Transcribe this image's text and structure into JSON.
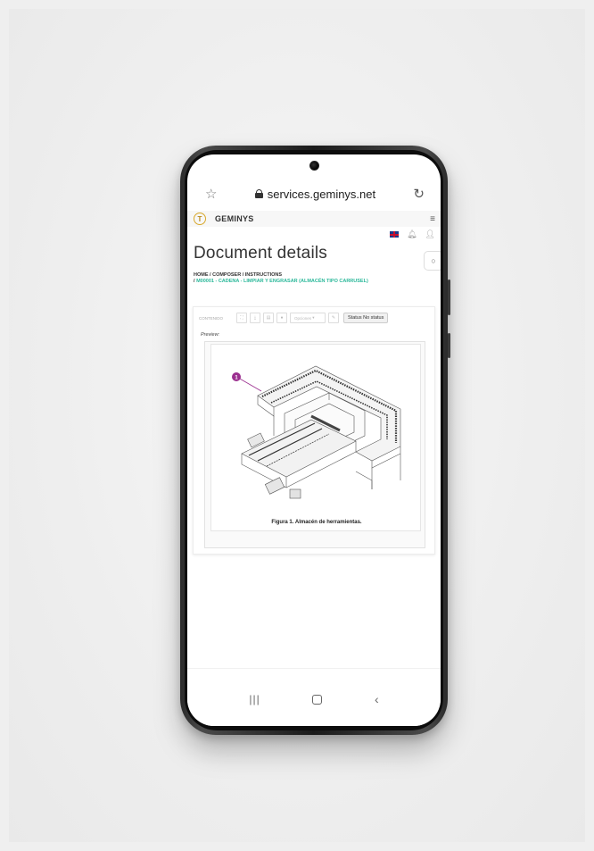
{
  "browser": {
    "url": "services.geminys.net"
  },
  "site": {
    "brand": "GEMINYS",
    "logo_letter": "T"
  },
  "page": {
    "title": "Document details",
    "breadcrumb": {
      "home": "HOME",
      "composer": "COMPOSER",
      "instructions": "INSTRUCTIONS",
      "current": "M00001 - CADENA - LIMPIAR Y ENGRASAR (ALMACÉN TIPO CARRUSEL)"
    }
  },
  "toolbar": {
    "content_label": "CONTENIDO",
    "options_label": "Opciones",
    "status_label": "Status No status"
  },
  "preview": {
    "label": "Preview:",
    "callout_number": "1",
    "caption": "Figura 1. Almacén de herramientas."
  },
  "colors": {
    "accent": "#2bb89a",
    "callout": "#9b2f8f",
    "logo": "#d8a82a"
  },
  "icons": {
    "star": "star-icon",
    "lock": "lock-icon",
    "reload": "reload-icon",
    "menu": "menu-icon",
    "flag": "flag-uk-icon",
    "bell": "bell-icon",
    "user": "user-icon"
  }
}
